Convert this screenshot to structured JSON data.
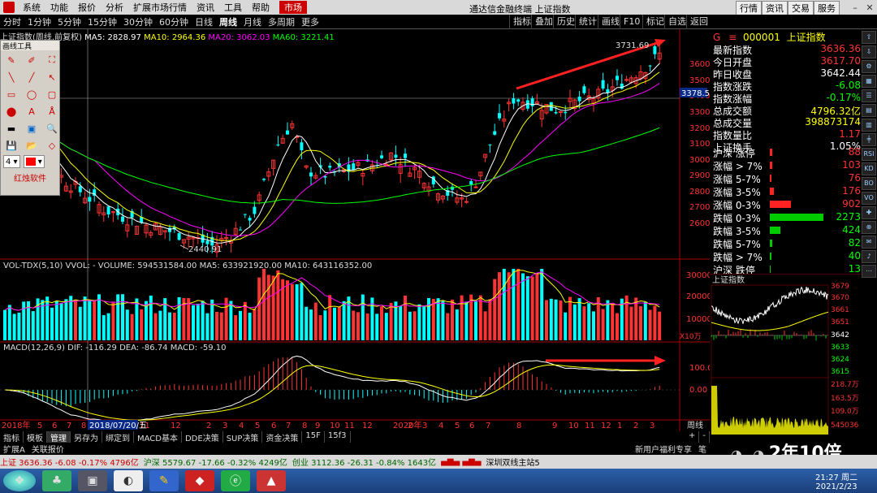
{
  "menubar": {
    "items": [
      "系统",
      "功能",
      "报价",
      "分析",
      "扩展市场行情",
      "资讯",
      "工具",
      "帮助"
    ],
    "market": "市场",
    "title": "通达信金融终端 上证指数",
    "right_buttons": [
      "行情",
      "资讯",
      "交易",
      "服务"
    ]
  },
  "toolbar": {
    "periods": [
      "分时",
      "1分钟",
      "5分钟",
      "15分钟",
      "30分钟",
      "60分钟",
      "日线",
      "周线",
      "月线",
      "多周期",
      "更多"
    ],
    "selected": "周线",
    "right": [
      "指标",
      "叠加",
      "历史",
      "统计",
      "画线",
      "F10",
      "标记",
      "自选",
      "返回"
    ]
  },
  "info": {
    "name": "上证指数(周线,前复权)",
    "ma5": "MA5: 2828.97",
    "ma10": "MA10: 2964.36",
    "ma20": "MA20: 3062.03",
    "ma60": "MA60: 3221.41"
  },
  "draw_panel": {
    "title": "画线工具",
    "size": "4",
    "brand": "红烛软件"
  },
  "price_axis": [
    "3600",
    "3500",
    "3400",
    "3300",
    "3200",
    "3100",
    "3000",
    "2900",
    "2800",
    "2700",
    "2600"
  ],
  "annotations": {
    "high": "3731.69",
    "low": "2440.91",
    "cursor": "3378.5"
  },
  "volume": {
    "title": "VOL-TDX(5,10) VVOL: -  VOLUME: 594531584.00  MA5: 633921920.00  MA10: 643116352.00",
    "axis": [
      "30000",
      "20000",
      "10000"
    ],
    "unit": "X10万"
  },
  "macd": {
    "title": "MACD(12,26,9)  DIF: -116.29  DEA: -86.74  MACD: -59.10",
    "axis": [
      "100.00",
      "0.00"
    ]
  },
  "timeaxis": {
    "labels": [
      "2018年",
      "5",
      "6",
      "7",
      "8",
      "9",
      "10",
      "11",
      "12",
      "2",
      "3",
      "4",
      "5",
      "6",
      "7",
      "8",
      "9",
      "10",
      "11",
      "12",
      "2020年",
      "2",
      "3",
      "4",
      "5",
      "6",
      "7",
      "8",
      "9",
      "10",
      "11",
      "12",
      "1",
      "2",
      "3"
    ],
    "cursor_date": "2018/07/20/五",
    "period": "周线"
  },
  "stock": {
    "code": "000001",
    "name": "上证指数",
    "rows": [
      {
        "k": "最新指数",
        "v": "3636.36",
        "c": "red"
      },
      {
        "k": "今日开盘",
        "v": "3617.70",
        "c": "red"
      },
      {
        "k": "昨日收盘",
        "v": "3642.44",
        "c": "wht"
      },
      {
        "k": "指数涨跌",
        "v": "-6.08",
        "c": "grn"
      },
      {
        "k": "指数涨幅",
        "v": "-0.17%",
        "c": "grn"
      },
      {
        "k": "总成交额",
        "v": "4796.32亿",
        "c": "yel"
      },
      {
        "k": "总成交量",
        "v": "398873174",
        "c": "yel"
      },
      {
        "k": "指数量比",
        "v": "1.17",
        "c": "red"
      },
      {
        "k": "上证换手",
        "v": "1.05%",
        "c": "wht"
      }
    ],
    "breadth": [
      {
        "k": "沪深 涨停",
        "v": "88",
        "c": "red",
        "w": 3
      },
      {
        "k": "涨幅 > 7%",
        "v": "103",
        "c": "red",
        "w": 3
      },
      {
        "k": "涨幅 5-7%",
        "v": "76",
        "c": "red",
        "w": 2
      },
      {
        "k": "涨幅 3-5%",
        "v": "176",
        "c": "red",
        "w": 5
      },
      {
        "k": "涨幅 0-3%",
        "v": "902",
        "c": "red",
        "w": 26
      },
      {
        "k": "跌幅 0-3%",
        "v": "2273",
        "c": "grn",
        "w": 66
      },
      {
        "k": "跌幅 3-5%",
        "v": "424",
        "c": "grn",
        "w": 13
      },
      {
        "k": "跌幅 5-7%",
        "v": "82",
        "c": "grn",
        "w": 3
      },
      {
        "k": "跌幅 > 7%",
        "v": "40",
        "c": "grn",
        "w": 2
      },
      {
        "k": "沪深 跌停",
        "v": "13",
        "c": "grn",
        "w": 1
      }
    ]
  },
  "mini": {
    "title": "上证指数",
    "axis": [
      "3679",
      "3670",
      "3661",
      "3651",
      "3642",
      "3633",
      "3624",
      "3615",
      "218.7万",
      "163.5万",
      "109.0万",
      "545036"
    ]
  },
  "bottom_tabs": [
    "指标",
    "模板",
    "管理",
    "另存为",
    "绑定到",
    "MACD基本",
    "DDE决策",
    "SUP决策",
    "资金决策",
    "15F",
    "15f3"
  ],
  "bottom_tabs2": [
    "扩展A",
    "关联报价"
  ],
  "bottom_right": {
    "notice": "新用户福利专享",
    "note": "笔",
    "plus": "+",
    "minus": "-"
  },
  "status": {
    "sh": "上证 3636.36  -6.08  -0.17%  4796亿",
    "sz": "沪深 5579.67  -17.66  -0.32%  4249亿",
    "cy": "创业 3112.36  -26.31  -0.84%  1643亿",
    "station": "深圳双线主站5"
  },
  "taskbar": {
    "time": "21:27 周二",
    "date": "2021/2/23"
  },
  "watermark": "2年10倍",
  "colors": {
    "up": "#ff3333",
    "down": "#00ffff",
    "ma5": "#ffffff",
    "ma10": "#ffff00",
    "ma20": "#ff00ff",
    "ma60": "#00ff00",
    "arrow": "#ff2020"
  }
}
